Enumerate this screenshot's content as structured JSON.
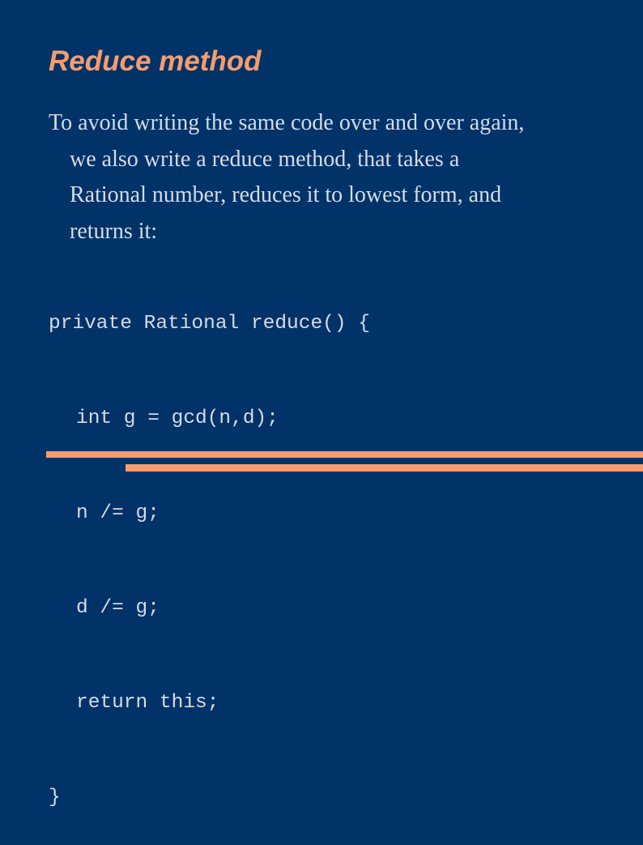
{
  "slide": {
    "title": "Reduce method",
    "paragraph_lines": [
      "To avoid writing the same code over and over again,",
      "we also write a reduce method, that takes a",
      "Rational number, reduces it to lowest form, and",
      "returns it:"
    ],
    "code_lines": [
      "private Rational reduce() {",
      "int g = gcd(n,d);",
      "n /= g;",
      "d /= g;",
      "return this;",
      "}"
    ],
    "colors": {
      "background": "#013368",
      "accent": "#f89c6c",
      "text": "#d4dbe8"
    }
  }
}
